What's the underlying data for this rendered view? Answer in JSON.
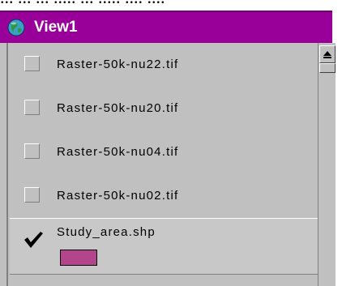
{
  "top_caption": "... ... ... ..... ... ..... .... ....",
  "window": {
    "title": "View1",
    "icon": "globe-icon",
    "accent_color": "#990099"
  },
  "toc": {
    "themes": [
      {
        "label": "Raster-50k-nu22.tif",
        "checked": false
      },
      {
        "label": "Raster-50k-nu20.tif",
        "checked": false
      },
      {
        "label": "Raster-50k-nu04.tif",
        "checked": false
      },
      {
        "label": "Raster-50k-nu02.tif",
        "checked": false
      },
      {
        "label": "Study_area.shp",
        "checked": true,
        "legend_color": "#b2458c"
      }
    ]
  },
  "scrollbar": {
    "up_arrow_icon": "arrow-up-icon"
  }
}
